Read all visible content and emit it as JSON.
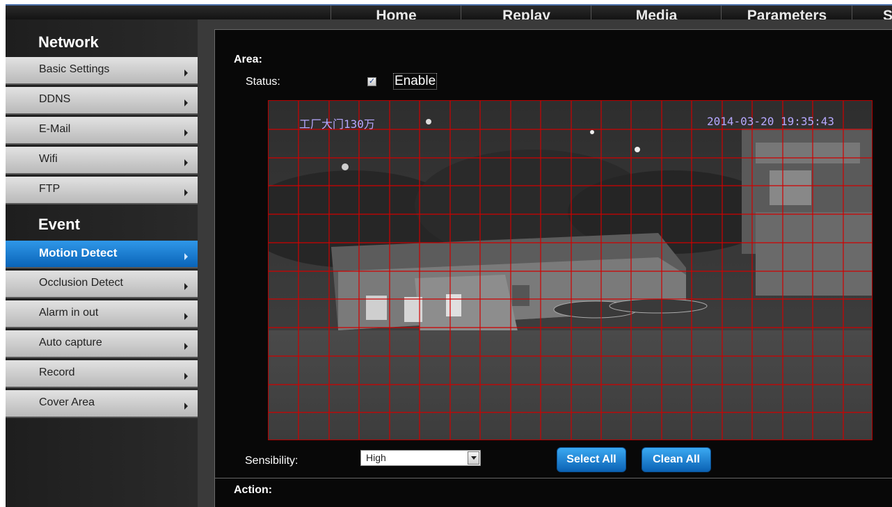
{
  "nav": {
    "tabs": [
      {
        "label": "Home"
      },
      {
        "label": "Replay"
      },
      {
        "label": "Media"
      },
      {
        "label": "Parameters"
      },
      {
        "label": "S"
      }
    ]
  },
  "sidebar": {
    "network_heading": "Network",
    "network_items": [
      {
        "label": "Basic Settings"
      },
      {
        "label": "DDNS"
      },
      {
        "label": "E-Mail"
      },
      {
        "label": "Wifi"
      },
      {
        "label": "FTP"
      }
    ],
    "event_heading": "Event",
    "event_items": [
      {
        "label": "Motion Detect",
        "active": true
      },
      {
        "label": "Occlusion Detect"
      },
      {
        "label": "Alarm in out"
      },
      {
        "label": "Auto capture"
      },
      {
        "label": "Record"
      },
      {
        "label": "Cover Area"
      }
    ]
  },
  "area": {
    "heading": "Area:",
    "status_label": "Status:",
    "enable_checked": true,
    "enable_label": "Enable",
    "camera_osd_name": "工厂大门130万",
    "camera_osd_time": "2014-03-20 19:35:43",
    "grid_color": "#d00000",
    "sensibility_label": "Sensibility:",
    "sensibility_value": "High",
    "select_all_label": "Select All",
    "clean_all_label": "Clean All"
  },
  "action": {
    "heading": "Action:"
  },
  "colors": {
    "accent_blue": "#0a64b8",
    "sidebar_gray": "#c8c8c8",
    "background": "#000000"
  }
}
